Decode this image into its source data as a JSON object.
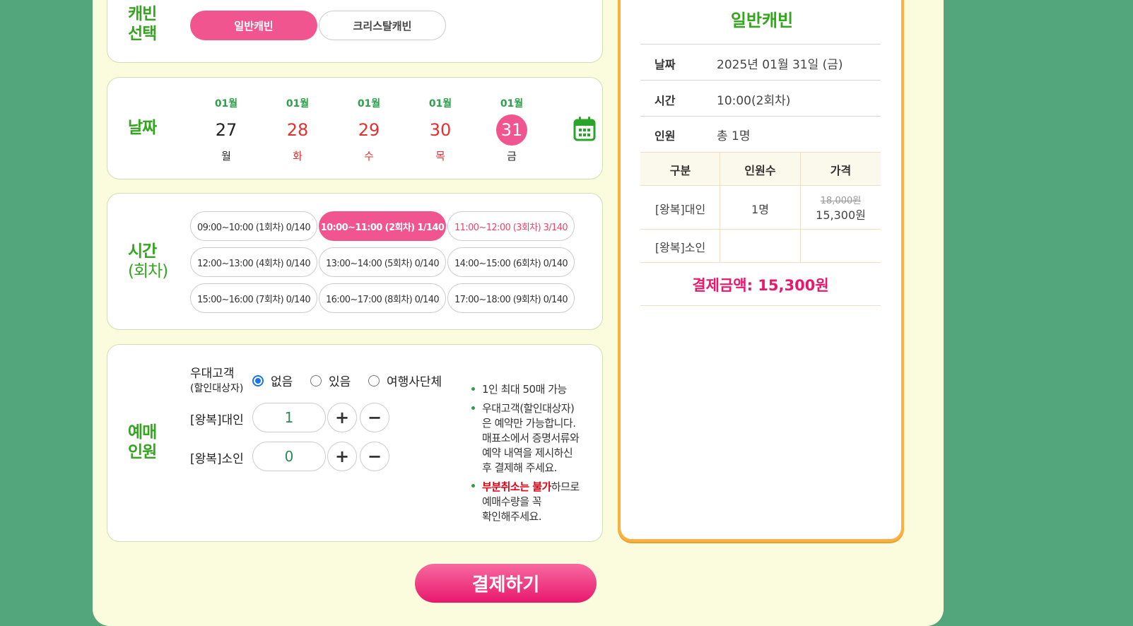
{
  "cabin": {
    "title_line1": "캐빈",
    "title_line2": "선택",
    "options": [
      "일반캐빈",
      "크리스탈캐빈"
    ],
    "selected": "일반캐빈"
  },
  "date": {
    "title": "날짜",
    "days": [
      {
        "month": "01월",
        "day": "27",
        "weekday": "월"
      },
      {
        "month": "01월",
        "day": "28",
        "weekday": "화"
      },
      {
        "month": "01월",
        "day": "29",
        "weekday": "수"
      },
      {
        "month": "01월",
        "day": "30",
        "weekday": "목"
      },
      {
        "month": "01월",
        "day": "31",
        "weekday": "금"
      }
    ],
    "selected_day": "31"
  },
  "time": {
    "title_line1": "시간",
    "title_line2": "(회차)",
    "slots": [
      "09:00~10:00 (1회차) 0/140",
      "10:00~11:00 (2회차) 1/140",
      "11:00~12:00 (3회차) 3/140",
      "12:00~13:00 (4회차) 0/140",
      "13:00~14:00 (5회차) 0/140",
      "14:00~15:00 (6회차) 0/140",
      "15:00~16:00 (7회차) 0/140",
      "16:00~17:00 (8회차) 0/140",
      "17:00~18:00 (9회차) 0/140"
    ],
    "selected_index": 1
  },
  "people": {
    "title_line1": "예매",
    "title_line2": "인원",
    "discount_label": "우대고객",
    "discount_sub": "(할인대상자)",
    "radio_options": [
      "없음",
      "있음",
      "여행사단체"
    ],
    "radio_selected": "없음",
    "adult_label": "[왕복]대인",
    "adult_qty": "1",
    "child_label": "[왕복]소인",
    "child_qty": "0",
    "plus": "+",
    "minus": "−",
    "notes": {
      "note1": "1인 최대 50매 가능",
      "note2_lines": [
        "우대고객(할인대상자)",
        "은 예약만 가능합니다.",
        "매표소에서 증명서류와",
        "예약 내역을 제시하신",
        "후 결제해 주세요."
      ],
      "note3_red": "부분취소는 불가",
      "note3_rest": "하므로",
      "note3_lines": [
        "예매수량을 꼭",
        "확인해주세요."
      ]
    }
  },
  "pay_button": "결제하기",
  "summary": {
    "title": "일반캐빈",
    "date_label": "날짜",
    "date_value": "2025년 01월 31일 (금)",
    "time_label": "시간",
    "time_value": "10:00(2회차)",
    "people_label": "인원",
    "people_value": "총 1명",
    "headers": [
      "구분",
      "인원수",
      "가격"
    ],
    "rows": [
      {
        "type": "[왕복]대인",
        "count": "1명",
        "original_price": "18,000원",
        "price": "15,300원"
      },
      {
        "type": "[왕복]소인",
        "count": "",
        "original_price": "",
        "price": ""
      }
    ],
    "total": "결제금액: 15,300원"
  },
  "colors": {
    "accent_green": "#33a61e",
    "accent_pink": "#f05590",
    "summary_border": "#fbb040",
    "background": "#53a57b"
  }
}
